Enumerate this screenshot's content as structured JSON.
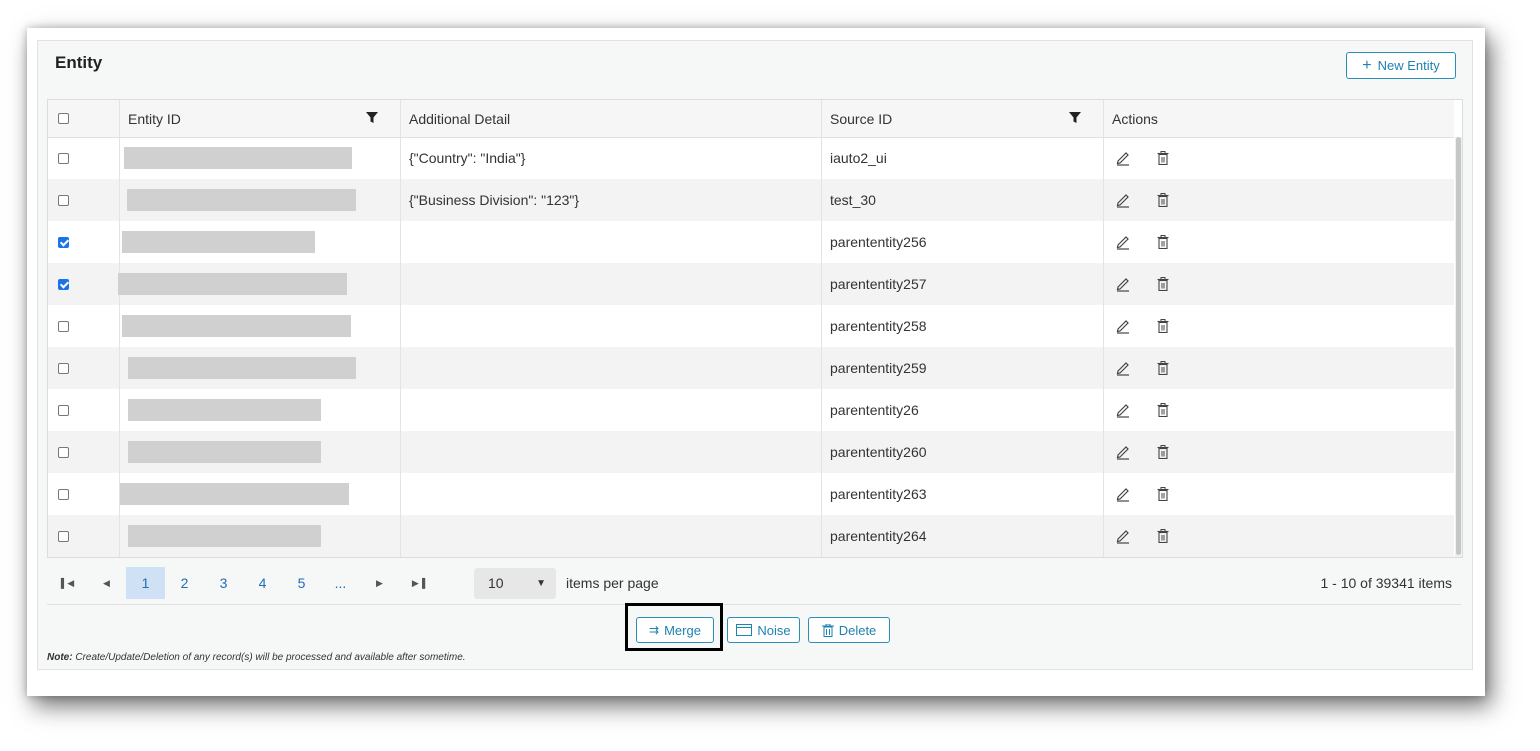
{
  "card": {
    "title": "Entity",
    "new_button": "New Entity"
  },
  "table": {
    "headers": [
      "Entity ID",
      "Additional Detail",
      "Source ID",
      "Actions"
    ],
    "rows": [
      {
        "checked": false,
        "detail": "{\"Country\": \"India\"}",
        "source": "iauto2_ui"
      },
      {
        "checked": false,
        "detail": "{\"Business Division\": \"123\"}",
        "source": "test_30"
      },
      {
        "checked": true,
        "detail": "",
        "source": "parententity256"
      },
      {
        "checked": true,
        "detail": "",
        "source": "parententity257"
      },
      {
        "checked": false,
        "detail": "",
        "source": "parententity258"
      },
      {
        "checked": false,
        "detail": "",
        "source": "parententity259"
      },
      {
        "checked": false,
        "detail": "",
        "source": "parententity26"
      },
      {
        "checked": false,
        "detail": "",
        "source": "parententity260"
      },
      {
        "checked": false,
        "detail": "",
        "source": "parententity263"
      },
      {
        "checked": false,
        "detail": "",
        "source": "parententity264"
      }
    ]
  },
  "pager": {
    "pages": [
      "1",
      "2",
      "3",
      "4",
      "5",
      "..."
    ],
    "active_page": "1",
    "per_page": "10",
    "per_page_label": "items per page",
    "count": "1 - 10 of 39341 items"
  },
  "footer": {
    "merge": "Merge",
    "noise": "Noise",
    "delete": "Delete"
  },
  "note": {
    "prefix": "Note:",
    "text": " Create/Update/Deletion of any record(s) will be processed and available after sometime."
  },
  "colors": {
    "accent": "#1f82b0",
    "checked": "#1a73e8",
    "active_page": "#cfe1f4"
  }
}
